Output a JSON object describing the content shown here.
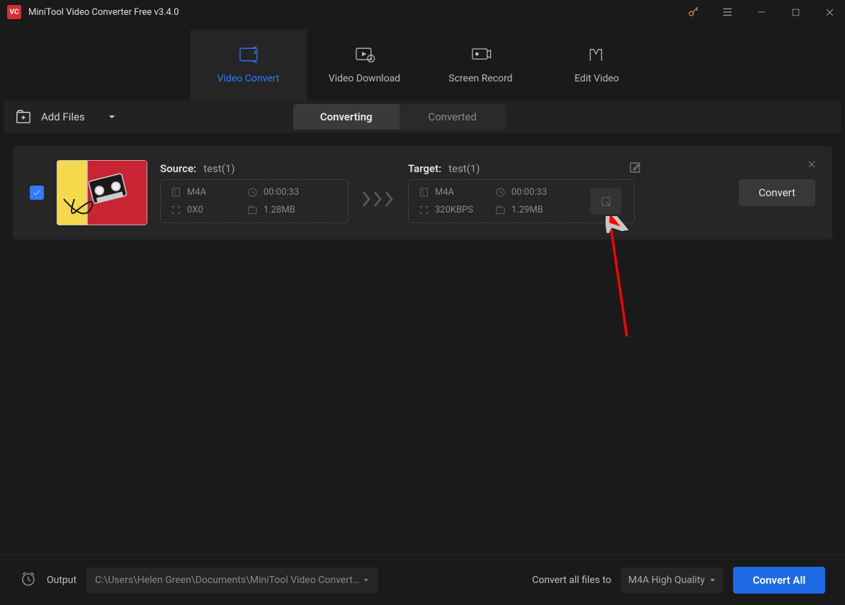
{
  "app": {
    "title": "MiniTool Video Converter Free v3.4.0"
  },
  "tabs": {
    "video_convert": "Video Convert",
    "video_download": "Video Download",
    "screen_record": "Screen Record",
    "edit_video": "Edit Video"
  },
  "toolbar": {
    "add_files": "Add Files",
    "converting": "Converting",
    "converted": "Converted"
  },
  "item": {
    "source_label": "Source:",
    "source_file": "test(1)",
    "target_label": "Target:",
    "target_file": "test(1)",
    "src": {
      "format": "M4A",
      "duration": "00:00:33",
      "resolution": "0X0",
      "size": "1.28MB"
    },
    "tgt": {
      "format": "M4A",
      "duration": "00:00:33",
      "bitrate": "320KBPS",
      "size": "1.29MB"
    },
    "convert": "Convert"
  },
  "footer": {
    "output_label": "Output",
    "output_path": "C:\\Users\\Helen Green\\Documents\\MiniTool Video Converter\\c",
    "convert_all_to": "Convert all files to",
    "format": "M4A High Quality",
    "convert_all": "Convert All"
  }
}
